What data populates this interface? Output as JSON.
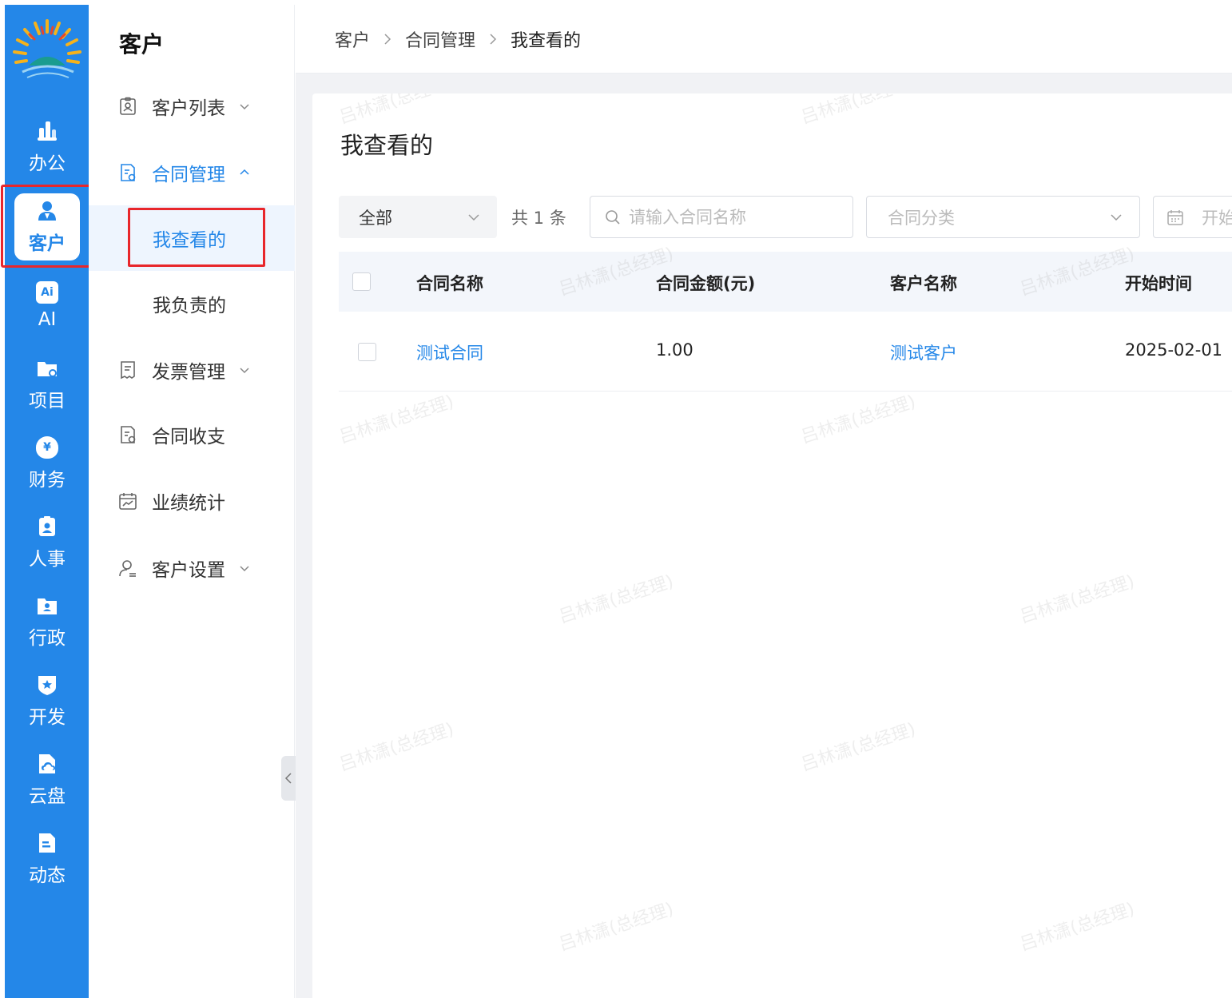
{
  "rail": {
    "items": [
      {
        "label": "办公",
        "icon": "office-icon"
      },
      {
        "label": "客户",
        "icon": "customer-icon"
      },
      {
        "label": "AI",
        "icon": "ai-icon"
      },
      {
        "label": "项目",
        "icon": "project-folder-icon"
      },
      {
        "label": "财务",
        "icon": "money-bag-icon"
      },
      {
        "label": "人事",
        "icon": "personnel-badge-icon"
      },
      {
        "label": "行政",
        "icon": "admin-folder-icon"
      },
      {
        "label": "开发",
        "icon": "shield-star-icon"
      },
      {
        "label": "云盘",
        "icon": "cloud-file-icon"
      },
      {
        "label": "动态",
        "icon": "feed-document-icon"
      }
    ],
    "active_index": 1,
    "ai_icon_text": "Ai",
    "finance_icon_text": "¥"
  },
  "sidebar": {
    "title": "客户",
    "menu": {
      "customer_list": "客户列表",
      "contract_mgmt": "合同管理",
      "viewed_by_me": "我查看的",
      "my_responsible": "我负责的",
      "invoice_mgmt": "发票管理",
      "contract_income": "合同收支",
      "performance_stats": "业绩统计",
      "customer_settings": "客户设置"
    }
  },
  "breadcrumb": {
    "level1": "客户",
    "level2": "合同管理",
    "current": "我查看的"
  },
  "page": {
    "title": "我查看的",
    "filter_scope": "全部",
    "count_text": "共 1 条",
    "search_placeholder": "请输入合同名称",
    "category_placeholder": "合同分类",
    "date_placeholder": "开始"
  },
  "table": {
    "headers": [
      "合同名称",
      "合同金额(元)",
      "客户名称",
      "开始时间"
    ],
    "rows": [
      {
        "contract_name": "测试合同",
        "amount": "1.00",
        "customer": "测试客户",
        "start_date": "2025-02-01"
      }
    ]
  },
  "watermark": "吕林潇(总经理)",
  "colors": {
    "accent": "#2487e8",
    "rail": "#2487e8",
    "highlight": "#e8262b"
  }
}
